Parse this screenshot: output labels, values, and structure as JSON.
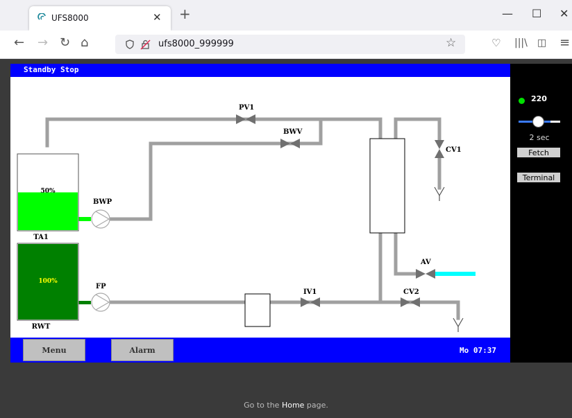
{
  "browser": {
    "tab_title": "UFS8000",
    "url": "ufs8000_999999"
  },
  "hmi": {
    "status": "Standby Stop",
    "clock": "Mo 07:37",
    "buttons": {
      "menu": "Menu",
      "alarm": "Alarm"
    },
    "labels": {
      "pv1": "PV1",
      "bwv": "BWV",
      "cv1": "CV1",
      "bwp": "BWP",
      "fp": "FP",
      "av": "AV",
      "iv1": "IV1",
      "cv2": "CV2",
      "ta1": "TA1",
      "rwt": "RWT"
    },
    "tanks": {
      "ta1_level_text": "50%",
      "ta1_level": 0.5,
      "rwt_level_text": "100%",
      "rwt_level": 1.0
    },
    "colors": {
      "green": "#00ff00",
      "dark_green": "#008000",
      "cyan": "#00ffff",
      "blue": "#0000ff",
      "pipe": "#a0a0a0"
    }
  },
  "side": {
    "indicator_value": "220",
    "slider_label": "2 sec",
    "fetch": "Fetch",
    "terminal": "Terminal"
  },
  "footer": {
    "before": "Go to the ",
    "link": "Home",
    "after": " page."
  }
}
